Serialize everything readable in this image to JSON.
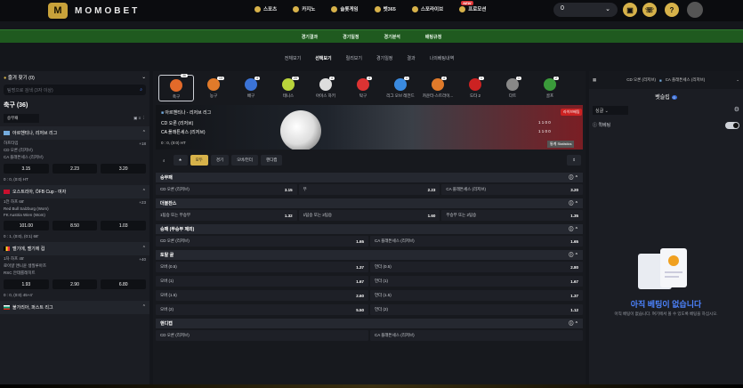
{
  "header": {
    "brand": "MOMOBET",
    "nav": [
      "스포츠",
      "카지노",
      "슬롯게임",
      "벳365",
      "스포라이브",
      "프로모션"
    ],
    "new_badge": "NEW",
    "balance": "0"
  },
  "greenbar": [
    "경기결과",
    "경기일정",
    "경기분석",
    "배팅규정"
  ],
  "subnav": [
    "전체보기",
    "선택보기",
    "릴리보기",
    "경기일정",
    "결과",
    "나의베팅내역"
  ],
  "left": {
    "favorites": "즐겨 찾기 (0)",
    "search_placeholder": "팀명으로 검색 (3자 이상)",
    "section": "축구 (36)",
    "filter": "승무패",
    "leagues": [
      {
        "name": "아르헨티나, 리저브 리그",
        "status": "하프타임",
        "count": "+18",
        "teams": [
          "CD 오론 (리저브)",
          "CA 플래튼세스 (리저브)"
        ],
        "odds": [
          "3.15",
          "2.23",
          "3.20"
        ],
        "score": "0 : 0, (0:0) HT"
      },
      {
        "name": "오스트리아, ÖFB Cup - 여자",
        "status": "1전 하프 68'",
        "count": "+23",
        "teams": [
          "Red Bull Salzburg (Wom)",
          "FK Austria Wien (Wom)"
        ],
        "odds": [
          "101.00",
          "8.50",
          "1.03"
        ],
        "score": "0 : 1, (0:0), (0:1) 68'"
      },
      {
        "name": "벨기에, 벨기에 컵",
        "status": "1차 하프 45'",
        "count": "+40",
        "teams": [
          "로이얄 앤니윤 생질루아즈",
          "RSC 안데를레히트"
        ],
        "odds": [
          "1.93",
          "2.90",
          "6.80"
        ],
        "score": "0 : 0, (0:0) 45+4'"
      },
      {
        "name": "불가리아, 퍼스트 리그",
        "status": "",
        "count": "",
        "teams": [],
        "odds": [],
        "score": ""
      }
    ]
  },
  "sports": [
    {
      "name": "축구",
      "count": "36"
    },
    {
      "name": "농구",
      "count": "13"
    },
    {
      "name": "배구",
      "count": "4"
    },
    {
      "name": "테니스",
      "count": "20"
    },
    {
      "name": "아이스 하키",
      "count": "4"
    },
    {
      "name": "탁구",
      "count": "4"
    },
    {
      "name": "리그 오브 레전드",
      "count": "1"
    },
    {
      "name": "카운터-스트라이...",
      "count": "4"
    },
    {
      "name": "도타 2",
      "count": "1"
    },
    {
      "name": "다트",
      "count": "1"
    },
    {
      "name": "골프",
      "count": "2"
    }
  ],
  "hero": {
    "league": "아르헨티나 - 리저브 리그",
    "live": "라이브배팅",
    "home": "CD 오론 (리저브)",
    "away": "CA 플래튼세스 (리저브)",
    "score_line1": "1  1  0  0",
    "score_line2": "1  1  0  0",
    "status": "0 : 0, (0:0) HT",
    "stats_btn": "통계  Statistics"
  },
  "tabs": [
    "모두",
    "경기",
    "오버/언더",
    "핸디캡"
  ],
  "markets": [
    {
      "title": "승무패",
      "rows": [
        [
          [
            "CD 오론 (리저브)",
            "3.15"
          ],
          [
            "무",
            "2.23"
          ],
          [
            "CA 플래튼세스 (리저브)",
            "3.20"
          ]
        ]
      ]
    },
    {
      "title": "더블찬스",
      "rows": [
        [
          [
            "1팀승 또는 무승부",
            "1.32"
          ],
          [
            "1팀승 또는 2팀승",
            "1.60"
          ],
          [
            "무승부 또는 2팀승",
            "1.35"
          ]
        ]
      ]
    },
    {
      "title": "승패 (무승부 제외)",
      "rows": [
        [
          [
            "CD 오론 (리저브)",
            "1.65"
          ],
          [
            "CA 플래튼세스 (리저브)",
            "1.65"
          ]
        ]
      ]
    },
    {
      "title": "토탈 골",
      "rows": [
        [
          [
            "오버 (0.5)",
            "1.37"
          ],
          [
            "언더 (0.5)",
            "2.80"
          ]
        ],
        [
          [
            "오버 (1)",
            "1.67"
          ],
          [
            "언더 (1)",
            "1.67"
          ]
        ],
        [
          [
            "오버 (1.5)",
            "2.60"
          ],
          [
            "언더 (1.5)",
            "1.37"
          ]
        ],
        [
          [
            "오버 (2)",
            "5.50"
          ],
          [
            "언더 (2)",
            "1.12"
          ]
        ]
      ]
    },
    {
      "title": "핸디캡",
      "rows": [
        [
          [
            "CD 오론 (리저브)",
            ""
          ],
          [
            "CA 플래튼세스 (리저브)",
            ""
          ]
        ]
      ]
    }
  ],
  "right": {
    "match": "CD 오론 (리저브)",
    "match2": "CA 플래튼세스 (리저브)",
    "betslip": "벳슬립",
    "betslip_count": "0",
    "select": "싱글",
    "quickbet": "퀵베팅",
    "empty_title": "아직 베팅이 없습니다",
    "empty_sub": "아직 베팅이 없습니다. 여기에서 볼 수 있도록 베팅을 하십시오."
  }
}
